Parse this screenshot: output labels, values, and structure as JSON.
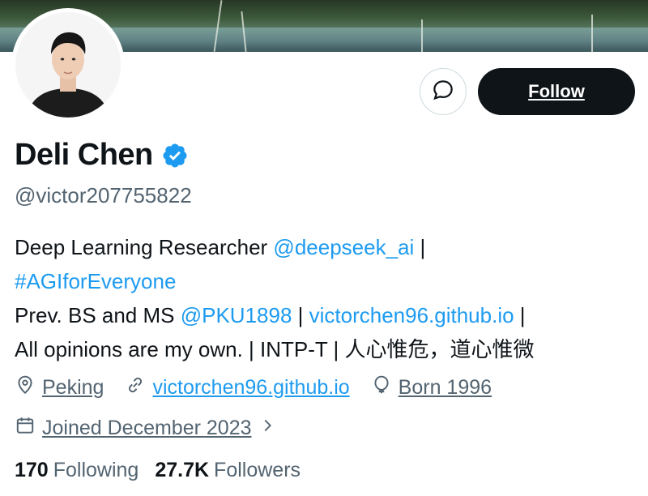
{
  "profile": {
    "name": "Deli Chen",
    "handle": "@victor207755822"
  },
  "actions": {
    "follow_label": "Follow"
  },
  "bio": {
    "line1_text": "Deep Learning Researcher ",
    "line1_mention": "@deepseek_ai",
    "line1_tail": " |",
    "line2_hashtag": "#AGIforEveryone",
    "line3_text": "Prev. BS and MS ",
    "line3_mention": "@PKU1898",
    "line3_sep": " | ",
    "line3_link": "victorchen96.github.io",
    "line3_tail": " |",
    "line4_text": "All opinions are my own. | INTP-T | 人心惟危，道心惟微"
  },
  "meta": {
    "location": "Peking",
    "website": "victorchen96.github.io",
    "born": "Born 1996",
    "joined": "Joined December 2023"
  },
  "stats": {
    "following_count": "170",
    "following_label": "Following",
    "followers_count": "27.7K",
    "followers_label": "Followers"
  },
  "icons": {
    "message": "message-icon",
    "verified": "verified-badge-icon",
    "location": "location-pin-icon",
    "link": "link-icon",
    "birthday": "balloon-icon",
    "calendar": "calendar-icon",
    "chevron": "chevron-right-icon"
  },
  "colors": {
    "accent": "#1d9bf0",
    "text": "#0f1419",
    "muted": "#536471",
    "button_dark": "#0f1419"
  }
}
